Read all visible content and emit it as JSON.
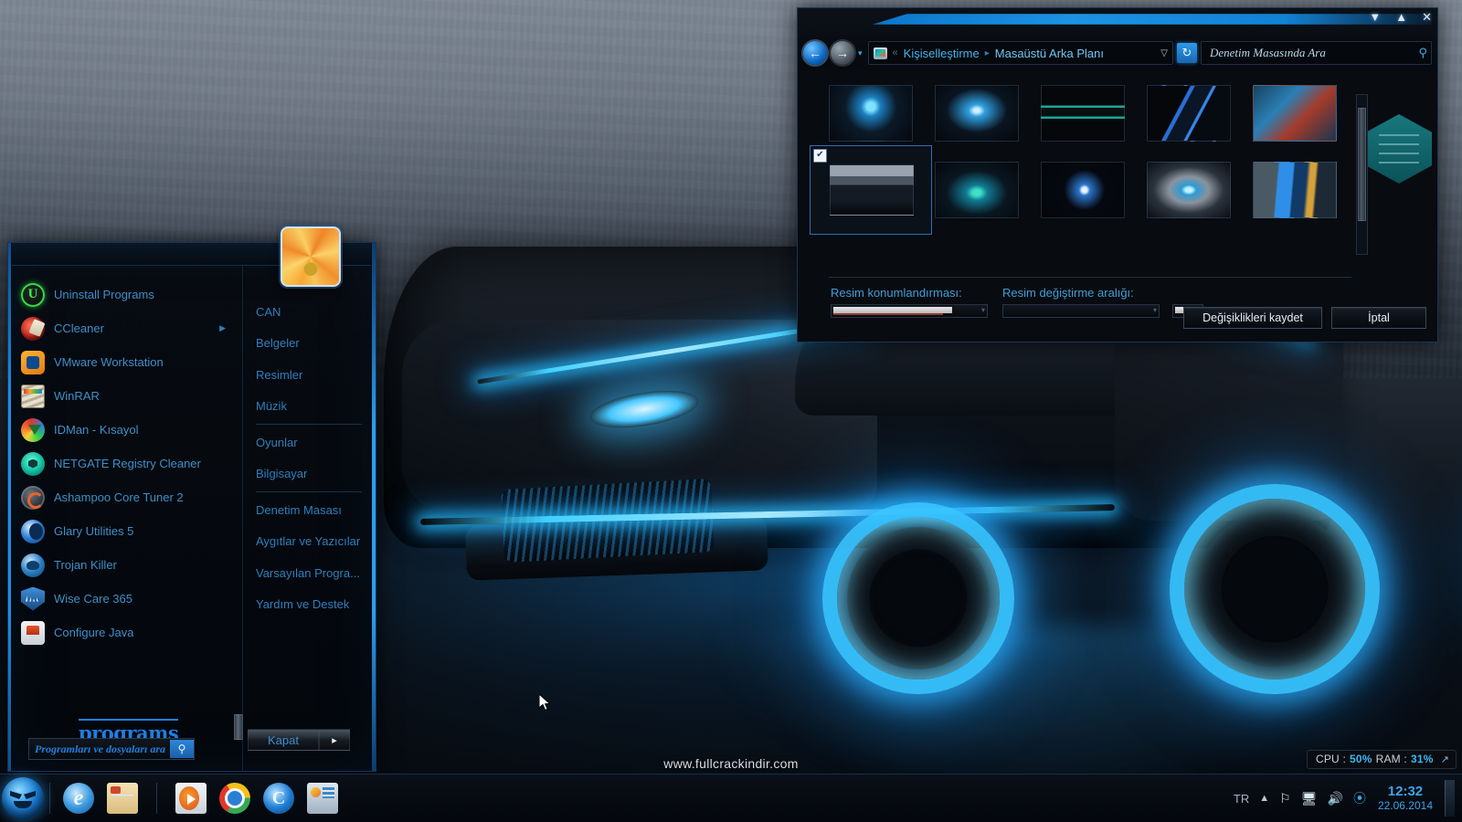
{
  "desktop": {
    "watermark": "www.fullcrackindir.com",
    "accent_blue": "#1f8fe0",
    "accent_cyan": "#3fd0ff"
  },
  "gadget": {
    "cpu_label": "CPU :",
    "cpu_value": "50%",
    "ram_label": "RAM :",
    "ram_value": "31%",
    "expand_icon": "arrow-up-right-icon"
  },
  "control_panel": {
    "window_buttons": {
      "minimize": "▼",
      "maximize": "▲",
      "close": "✕"
    },
    "nav": {
      "back_icon": "back-arrow-icon",
      "forward_icon": "forward-arrow-icon",
      "history_caret": "▾",
      "address_chevron": "«",
      "breadcrumbs": [
        "Kişiselleştirme",
        "Masaüstü Arka Planı"
      ],
      "breadcrumb_sep": "▸",
      "address_dropdown": "▽",
      "refresh_icon": "refresh-icon",
      "search_placeholder": "Denetim Masasında Ara",
      "search_value": "",
      "search_icon": "search-icon"
    },
    "thumbnails": {
      "row1": [
        {
          "name": "wallpaper-blue-sphere",
          "selected": false
        },
        {
          "name": "wallpaper-blue-core",
          "selected": false
        },
        {
          "name": "wallpaper-teal-emblem",
          "selected": false
        },
        {
          "name": "wallpaper-blue-lines",
          "selected": false
        },
        {
          "name": "wallpaper-robot",
          "selected": false
        }
      ],
      "row2": [
        {
          "name": "wallpaper-lamborghini",
          "selected": true,
          "check": "✔"
        },
        {
          "name": "wallpaper-cyan-glow",
          "selected": false
        },
        {
          "name": "wallpaper-windows-seven",
          "selected": false
        },
        {
          "name": "wallpaper-metal-capsule",
          "selected": false
        },
        {
          "name": "wallpaper-blue-waterfall",
          "selected": false
        }
      ]
    },
    "options": {
      "position_label": "Resim konumlandırması:",
      "interval_label": "Resim değiştirme aralığı:",
      "position_value": "",
      "interval_value": ""
    },
    "buttons": {
      "save": "Değişiklikleri kaydet",
      "cancel": "İptal"
    }
  },
  "start_menu": {
    "user_picture": "flower-avatar",
    "programs_link": "programs",
    "search_placeholder": "Programları ve dosyaları ara",
    "search_value": "",
    "search_icon": "search-icon",
    "shutdown_label": "Kapat",
    "shutdown_arrow": "▸",
    "left_items": [
      {
        "label": "Uninstall Programs",
        "icon": "uninstall-icon",
        "has_submenu": false
      },
      {
        "label": "CCleaner",
        "icon": "ccleaner-icon",
        "has_submenu": true
      },
      {
        "label": "VMware Workstation",
        "icon": "vmware-icon",
        "has_submenu": false
      },
      {
        "label": "WinRAR",
        "icon": "winrar-icon",
        "has_submenu": false
      },
      {
        "label": "IDMan - Kısayol",
        "icon": "idman-icon",
        "has_submenu": false
      },
      {
        "label": "NETGATE Registry Cleaner",
        "icon": "netgate-icon",
        "has_submenu": false
      },
      {
        "label": "Ashampoo Core Tuner 2",
        "icon": "ashampoo-icon",
        "has_submenu": false
      },
      {
        "label": "Glary Utilities 5",
        "icon": "glary-icon",
        "has_submenu": false
      },
      {
        "label": "Trojan Killer",
        "icon": "trojan-killer-icon",
        "has_submenu": false
      },
      {
        "label": "Wise Care 365",
        "icon": "wise-care-icon",
        "has_submenu": false
      },
      {
        "label": "Configure Java",
        "icon": "java-icon",
        "has_submenu": false
      }
    ],
    "right_items": [
      {
        "label": "CAN",
        "separator_after": false
      },
      {
        "label": "Belgeler",
        "separator_after": false
      },
      {
        "label": "Resimler",
        "separator_after": false
      },
      {
        "label": "Müzik",
        "separator_after": true
      },
      {
        "label": "Oyunlar",
        "separator_after": false
      },
      {
        "label": "Bilgisayar",
        "separator_after": true
      },
      {
        "label": "Denetim Masası",
        "separator_after": false
      },
      {
        "label": "Aygıtlar ve Yazıcılar",
        "separator_after": false
      },
      {
        "label": "Varsayılan Progra...",
        "separator_after": false
      },
      {
        "label": "Yardım ve Destek",
        "separator_after": false
      }
    ]
  },
  "taskbar": {
    "start_orb": "start-orb-icon",
    "pinned": [
      {
        "name": "internet-explorer-icon",
        "running": false
      },
      {
        "name": "windows-explorer-icon",
        "running": true
      },
      {
        "name": "windows-media-player-icon",
        "running": false
      },
      {
        "name": "google-chrome-icon",
        "running": false
      },
      {
        "name": "ccleaner-taskbar-icon",
        "running": false
      },
      {
        "name": "control-panel-icon",
        "running": true
      }
    ],
    "tray": {
      "language": "TR",
      "show_hidden": "˄",
      "flag_icon": "action-center-flag-icon",
      "network_icon": "network-icon",
      "volume_icon": "volume-icon",
      "ccleaner_tray_icon": "ccleaner-tray-icon",
      "time": "12:32",
      "date": "22.06.2014"
    }
  }
}
